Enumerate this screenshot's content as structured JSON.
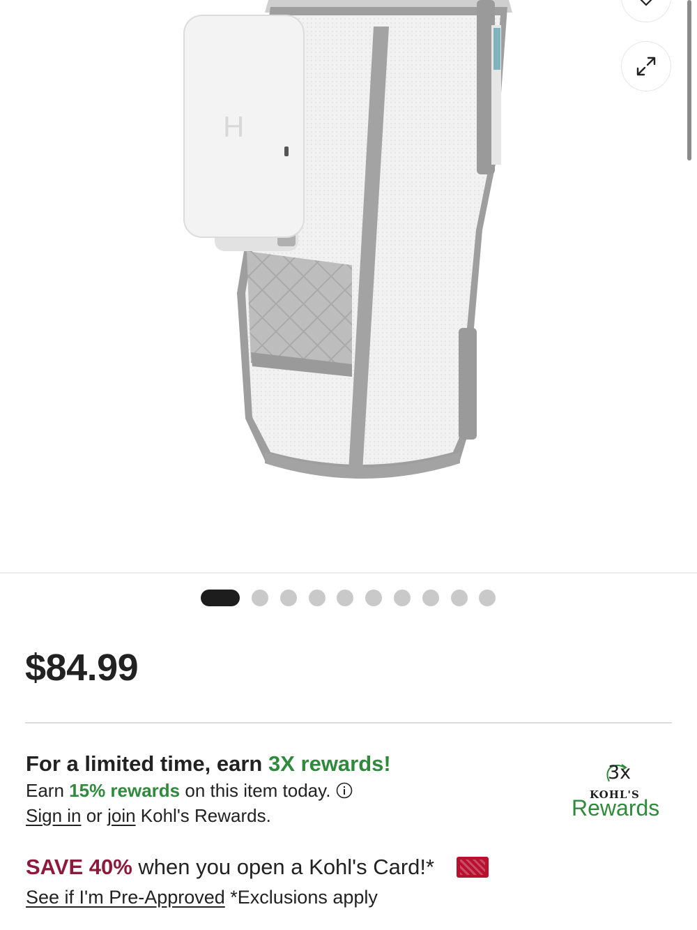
{
  "product": {
    "image_alt": "Homedics leg compression wrap",
    "carousel": {
      "total_images": 10,
      "active_index": 0
    }
  },
  "price": "$84.99",
  "rewards": {
    "headline_prefix": "For a limited time, earn ",
    "headline_highlight": "3X rewards!",
    "earn_prefix": "Earn ",
    "earn_highlight": "15% rewards",
    "earn_suffix": " on this item today.",
    "sign_in": "Sign in",
    "or_text": " or ",
    "join": "join",
    "program_suffix": " Kohl's Rewards."
  },
  "rewards_logo": {
    "multiplier": "3x",
    "brand": "KOHL'S",
    "program": "Rewards"
  },
  "card_offer": {
    "save": "SAVE 40%",
    "message": " when you open a Kohl's Card!*",
    "preapproved_link": "See if I'm Pre-Approved",
    "exclusions": " *Exclusions apply"
  },
  "colors": {
    "rewards_green": "#2f8a3b",
    "save_red": "#8c1a3c",
    "card_red": "#b8102f"
  },
  "icons": {
    "wishlist": "heart-icon",
    "expand": "expand-icon",
    "info": "info-icon"
  }
}
